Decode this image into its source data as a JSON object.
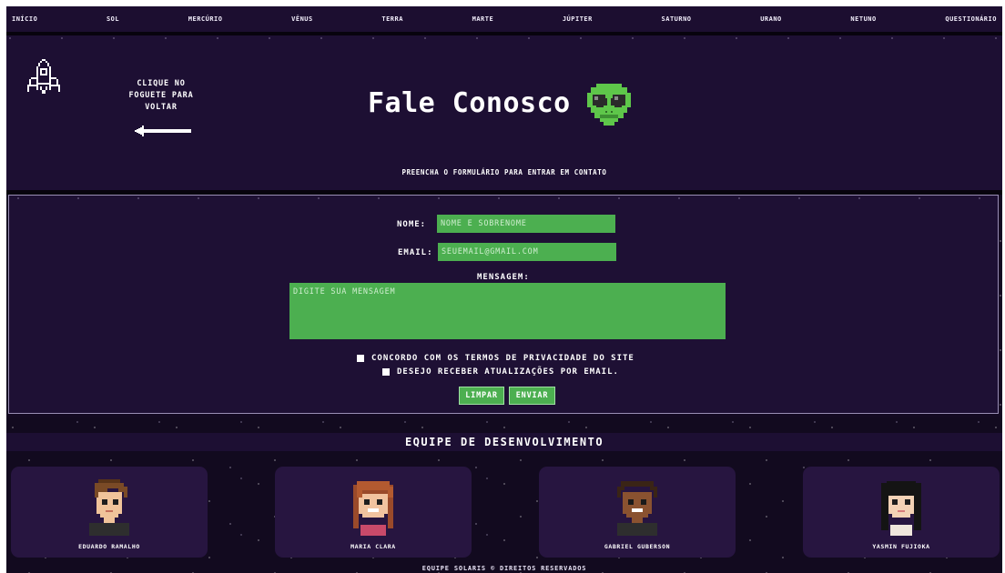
{
  "nav": {
    "items": [
      "INÍCIO",
      "SOL",
      "MERCÚRIO",
      "VÊNUS",
      "TERRA",
      "MARTE",
      "JÚPITER",
      "SATURNO",
      "URANO",
      "NETUNO",
      "QUESTIONÁRIO"
    ]
  },
  "header": {
    "back_text": "CLIQUE NO FOGUETE PARA VOLTAR",
    "title": "Fale Conosco",
    "subtitle": "PREENCHA O FORMULÁRIO PARA ENTRAR EM CONTATO"
  },
  "form": {
    "name_label": "NOME:",
    "name_placeholder": "NOME E SOBRENOME",
    "email_label": "EMAIL:",
    "email_placeholder": "SEUEMAIL@GMAIL.COM",
    "message_label": "MENSAGEM:",
    "message_placeholder": "DIGITE SUA MENSAGEM",
    "privacy_label": "CONCORDO COM OS TERMOS DE PRIVACIDADE DO SITE",
    "updates_label": "DESEJO RECEBER ATUALIZAÇÕES POR EMAIL.",
    "clear_label": "LIMPAR",
    "send_label": "ENVIAR"
  },
  "team": {
    "title": "EQUIPE DE DESENVOLVIMENTO",
    "members": [
      {
        "name": "EDUARDO RAMALHO"
      },
      {
        "name": "MARIA CLARA"
      },
      {
        "name": "GABRIEL GUBERSON"
      },
      {
        "name": "YASMIN FUJIOKA"
      }
    ]
  },
  "footer": {
    "text": "EQUIPE SOLARIS © DIREITOS RESERVADOS"
  },
  "colors": {
    "accent": "#4caf50",
    "background": "#1d0f33"
  }
}
